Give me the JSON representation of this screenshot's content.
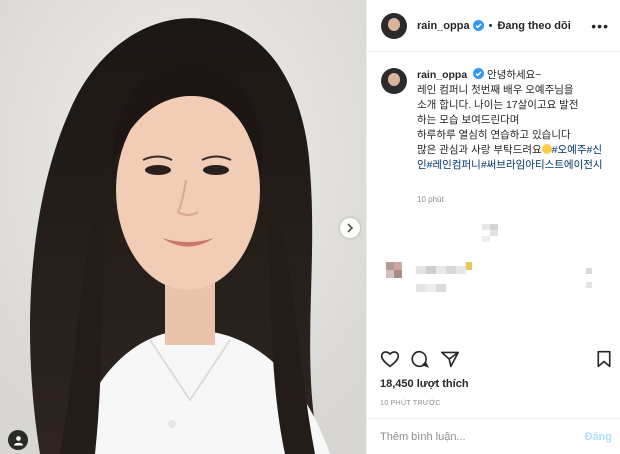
{
  "post": {
    "username": "rain_oppa",
    "follow_label": "Đang theo dõi",
    "dot": "•",
    "more_icon": "more-icon"
  },
  "caption": {
    "username": "rain_oppa",
    "lines": [
      "안녕하세요~",
      "레인 컴퍼니 첫번째 배우 오예주님을",
      "소개 합니다. 나이는 17살이고요 발전",
      "하는 모습 보여드린다며",
      "하루하루 열심히 연습하고 있습니다",
      "많은 관심과 사랑 부탁드려요"
    ],
    "hashtags": [
      "#오예주",
      "#신인",
      "#레인컴퍼니",
      "#써브라임아티스트에이전시"
    ],
    "time": "10 phút"
  },
  "stats": {
    "likes": "18,450 lượt thích",
    "posted": "10 PHÚT TRƯỚC"
  },
  "comment": {
    "placeholder": "Thêm bình luận...",
    "post_label": "Đăng"
  },
  "colors": {
    "link": "#00376b",
    "verified": "#3897f0",
    "post_disabled": "#b2dffc",
    "muted": "#8e8e8e"
  }
}
